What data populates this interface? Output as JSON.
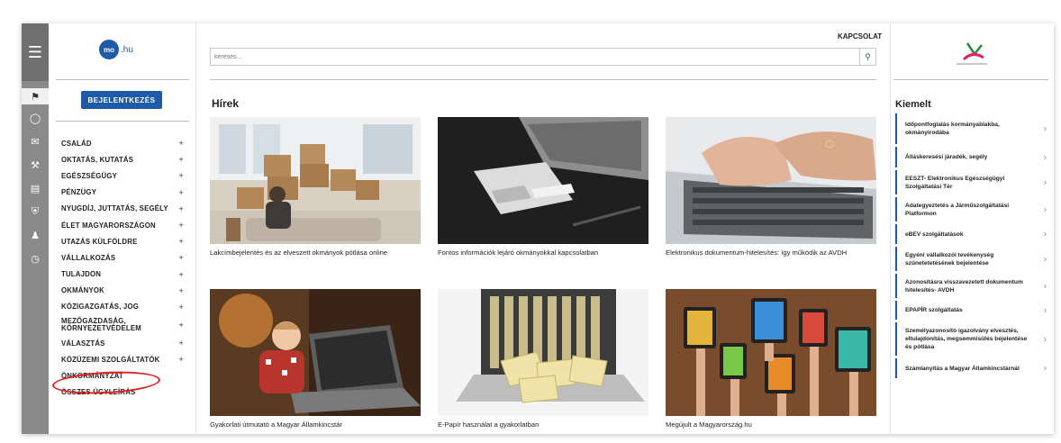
{
  "header": {
    "contact": "KAPCSOLAT"
  },
  "logo": {
    "badge": "mo",
    "tld": ".hu"
  },
  "login_button": "BEJELENTKEZÉS",
  "search": {
    "placeholder": "keresés..."
  },
  "nav": {
    "items": [
      {
        "label": "CSALÁD",
        "plus": "+"
      },
      {
        "label": "OKTATÁS, KUTATÁS",
        "plus": "+"
      },
      {
        "label": "EGÉSZSÉGÜGY",
        "plus": "+"
      },
      {
        "label": "PÉNZÜGY",
        "plus": "+"
      },
      {
        "label": "NYUGDÍJ, JUTTATÁS, SEGÉLY",
        "plus": "+"
      },
      {
        "label": "ÉLET MAGYARORSZÁGON",
        "plus": "+"
      },
      {
        "label": "UTAZÁS KÜLFÖLDRE",
        "plus": "+"
      },
      {
        "label": "VÁLLALKOZÁS",
        "plus": "+"
      },
      {
        "label": "TULAJDON",
        "plus": "+"
      },
      {
        "label": "OKMÁNYOK",
        "plus": "+"
      },
      {
        "label": "KÖZIGAZGATÁS, JOG",
        "plus": "+"
      },
      {
        "label": "MEZŐGAZDASÁG, KÖRNYEZETVÉDELEM",
        "plus": "+"
      },
      {
        "label": "VÁLASZTÁS",
        "plus": "+"
      },
      {
        "label": "KÖZÜZEMI SZOLGÁLTATÓK",
        "plus": "+"
      },
      {
        "label": "ÖNKORMÁNYZAT",
        "plus": ""
      },
      {
        "label": "ÖSSZES ÜGYLEÍRÁS",
        "plus": ""
      }
    ]
  },
  "news": {
    "title": "Hírek",
    "cards": [
      {
        "caption": "Lakcímbejelentés és az elveszett okmányok pótlása online",
        "image": "moving-boxes-photo"
      },
      {
        "caption": "Fontos információk lejáró okmányokkal kapcsolatban",
        "image": "laptop-card-reader-photo"
      },
      {
        "caption": "Elektronikus dokumentum-hitelesítés: így működik az AVDH",
        "image": "typing-hands-photo"
      },
      {
        "caption": "Gyakorlati útmutató a Magyar Államkincstár",
        "image": "child-laptop-photo"
      },
      {
        "caption": "E-Papír használat a gyakorlatban",
        "image": "envelopes-laptop-photo"
      },
      {
        "caption": "Megújult a Magyarország.hu",
        "image": "hands-devices-photo"
      }
    ]
  },
  "highlights": {
    "title": "Kiemelt",
    "items": [
      "Időpontfoglalás kormányablakba, okmányirodába",
      "Álláskeresési járadék, segély",
      "EESZT- Elektronikus Egészségügyi Szolgáltatási Tér",
      "Adategyeztetés a Járműszolgáltatási Platformon",
      "eBEV szolgáltatások",
      "Egyéni vállalkozói tevékenység szünetetetésének bejelentése",
      "Azonosításra visszavezetett dokumentum hitelesítés- AVDH",
      "EPAPÍR szolgáltatás",
      "Személyazonosító igazolvány elvesztés, eltulajdonítás, megsemmisülés bejelentése és pótlása",
      "Számlanyitás a Magyar Államkincstárnál"
    ]
  },
  "colors": {
    "brand": "#1d5aa8",
    "highlight_ring": "#e21d1d",
    "rail": "#8a8a8a"
  }
}
